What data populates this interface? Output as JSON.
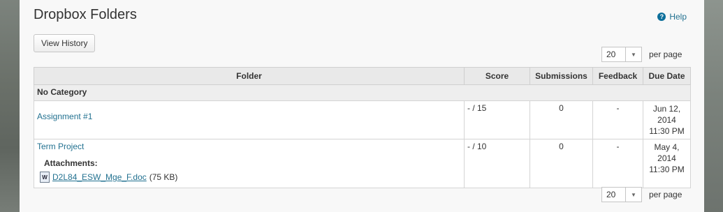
{
  "page": {
    "title": "Dropbox Folders"
  },
  "help": {
    "label": "Help",
    "icon": "help-circle-icon"
  },
  "toolbar": {
    "view_history_label": "View History"
  },
  "pagination": {
    "top": {
      "value": "20",
      "label": "per page"
    },
    "bottom": {
      "value": "20",
      "label": "per page"
    }
  },
  "table": {
    "headers": [
      "Folder",
      "Score",
      "Submissions",
      "Feedback",
      "Due Date"
    ],
    "category": "No Category",
    "rows": [
      {
        "folder": "Assignment #1",
        "score": "- / 15",
        "submissions": "0",
        "feedback": "-",
        "due_date": "Jun 12, 2014 11:30 PM"
      },
      {
        "folder": "Term Project",
        "score": "- / 10",
        "submissions": "0",
        "feedback": "-",
        "due_date": "May 4, 2014 11:30 PM",
        "attachments_label": "Attachments:",
        "attachment": {
          "name": "D2L84_ESW_Mge_F.doc",
          "size": "(75 KB)",
          "icon_letter": "W"
        }
      }
    ]
  },
  "colors": {
    "link": "#227190",
    "help_icon": "#0d6f9b"
  }
}
